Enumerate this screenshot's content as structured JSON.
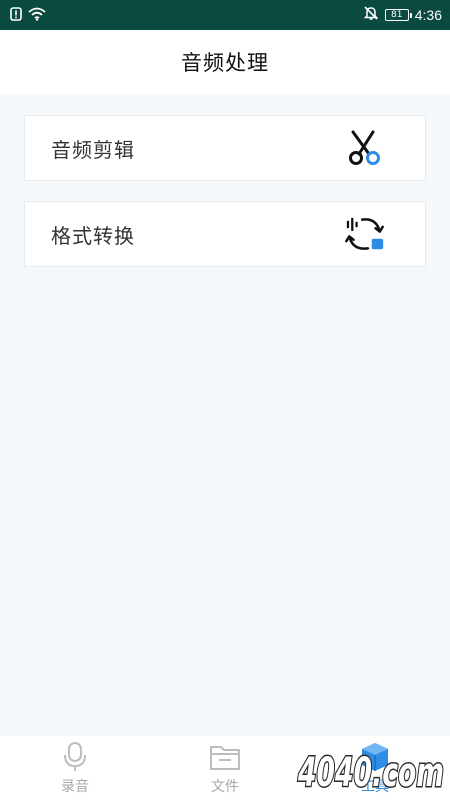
{
  "status_bar": {
    "battery": "81",
    "time": "4:36"
  },
  "header": {
    "title": "音频处理"
  },
  "cards": [
    {
      "label": "音频剪辑",
      "icon": "scissors-icon"
    },
    {
      "label": "格式转换",
      "icon": "convert-icon"
    }
  ],
  "bottom_nav": {
    "items": [
      {
        "label": "录音",
        "icon": "microphone-icon",
        "active": false
      },
      {
        "label": "文件",
        "icon": "folder-icon",
        "active": false
      },
      {
        "label": "工具",
        "icon": "toolbox-icon",
        "active": true
      }
    ]
  },
  "watermark": {
    "text": "4040.com"
  },
  "colors": {
    "status_bar": "#0b4a3f",
    "accent": "#2e8be6",
    "background": "#f5f9fc"
  }
}
